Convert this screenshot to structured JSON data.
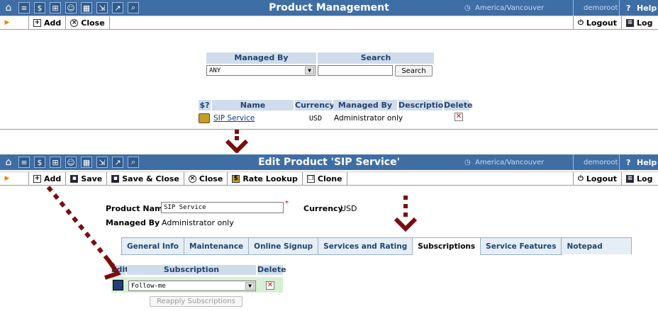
{
  "top": {
    "title": "Product Management",
    "timezone": "America/Vancouver",
    "user": "demoroot",
    "help": "Help",
    "toolbar": {
      "add": "Add",
      "close": "Close",
      "logout": "Logout",
      "log": "Log"
    },
    "filter": {
      "managed_by_header": "Managed By",
      "search_header": "Search",
      "managed_by_value": "ANY",
      "search_value": "",
      "search_button": "Search"
    },
    "table": {
      "headers": [
        "$?",
        "Name",
        "Currency",
        "Managed By",
        "Description",
        "Delete"
      ],
      "rows": [
        {
          "name": "SIP Service",
          "currency": "USD",
          "managed_by": "Administrator only",
          "description": ""
        }
      ]
    }
  },
  "bottom": {
    "title": "Edit Product 'SIP Service'",
    "timezone": "America/Vancouver",
    "user": "demoroot",
    "help": "Help",
    "toolbar": {
      "add": "Add",
      "save": "Save",
      "save_close": "Save & Close",
      "close": "Close",
      "rate_lookup": "Rate Lookup",
      "clone": "Clone",
      "logout": "Logout",
      "log": "Log"
    },
    "form": {
      "product_name_label": "Product Name",
      "product_name_value": "SIP Service",
      "required_mark": "*",
      "currency_label": "Currency",
      "currency_value": "USD",
      "managed_by_label": "Managed By",
      "managed_by_value": "Administrator only"
    },
    "tabs": [
      {
        "label": "General Info",
        "active": false
      },
      {
        "label": "Maintenance",
        "active": false
      },
      {
        "label": "Online Signup",
        "active": false
      },
      {
        "label": "Services and Rating",
        "active": false
      },
      {
        "label": "Subscriptions",
        "active": true
      },
      {
        "label": "Service Features",
        "active": false
      },
      {
        "label": "Notepad",
        "active": false
      }
    ],
    "subscriptions": {
      "headers": [
        "Edit",
        "Subscription",
        "Delete"
      ],
      "row_value": "Follow-me",
      "reapply_button": "Reapply Subscriptions"
    }
  },
  "colors": {
    "nav_bg": "#3f6ea5",
    "header_bg": "#cfdcec",
    "arrow": "#7a0e0e",
    "row_bg": "#d9efd5"
  }
}
